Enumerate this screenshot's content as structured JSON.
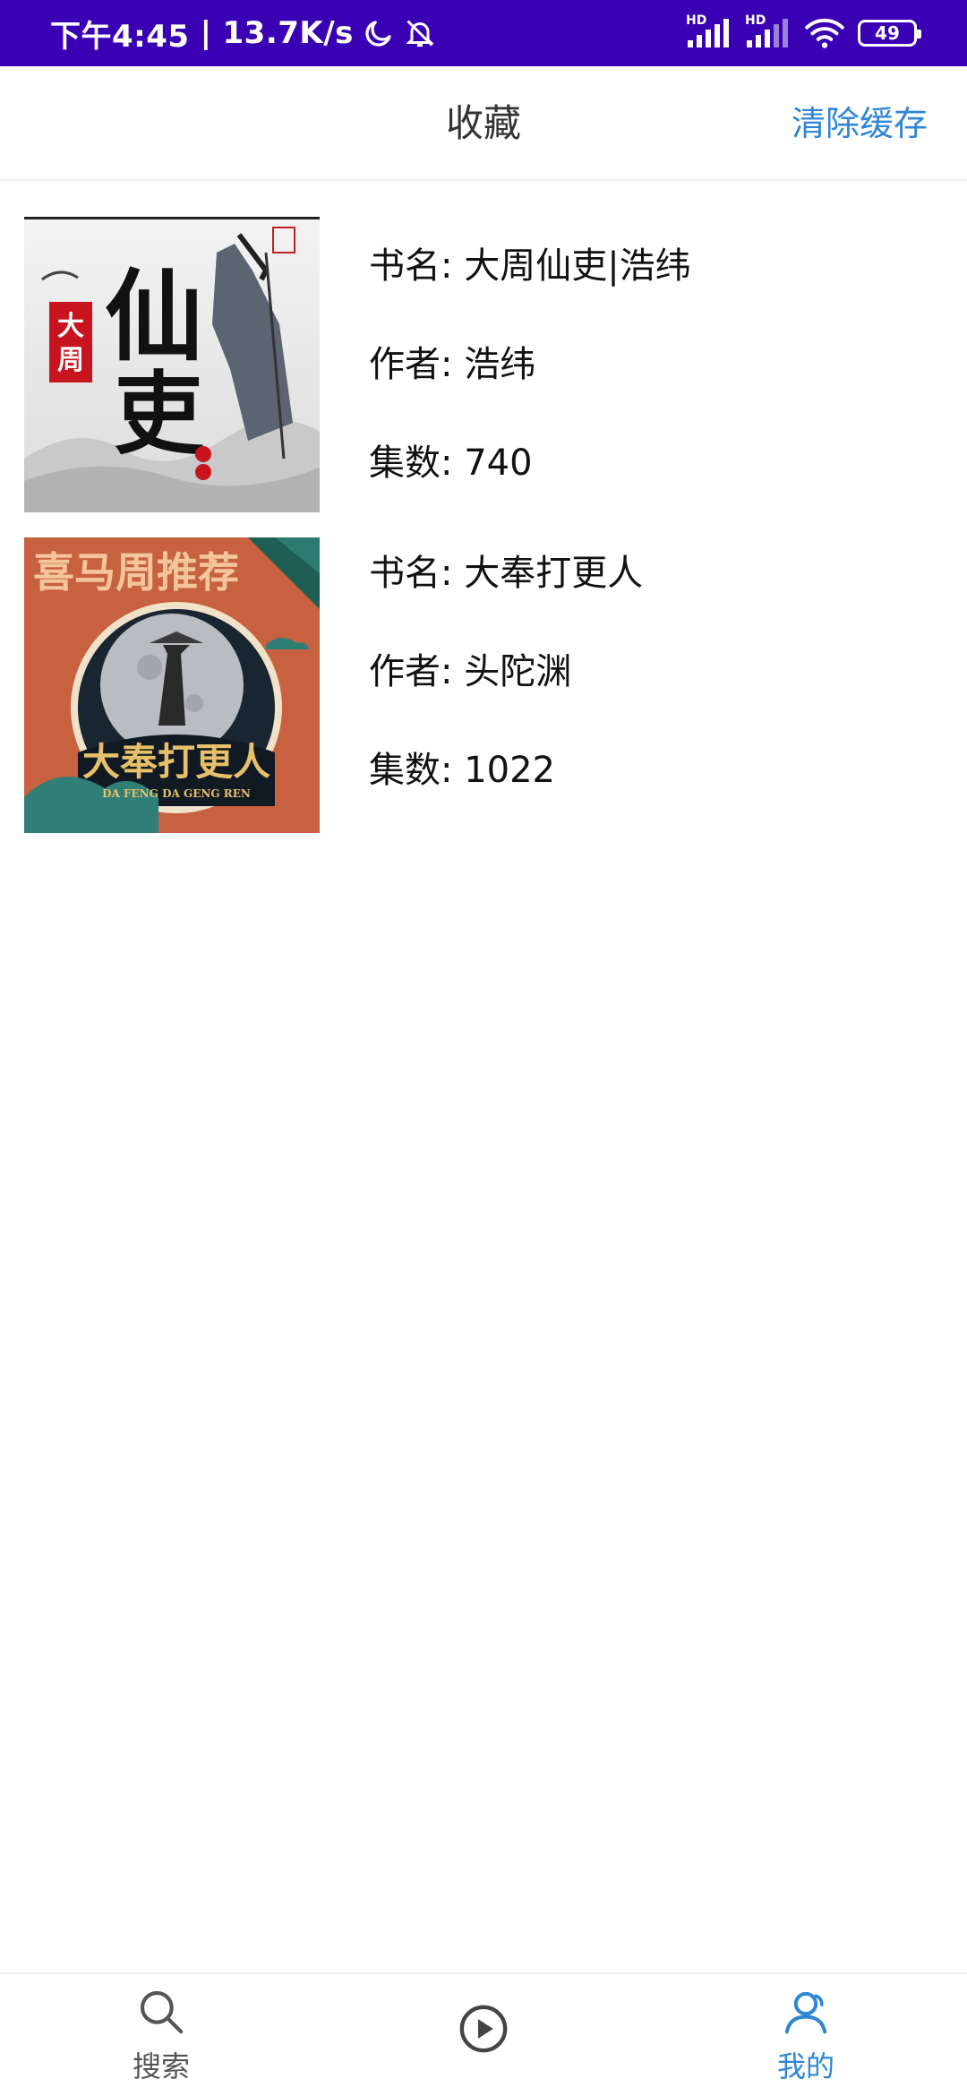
{
  "status_bar": {
    "time": "下午4:45",
    "separator": "|",
    "net_speed": "13.7K/s",
    "hd1": "HD",
    "hd2": "HD",
    "battery": "49",
    "icons": [
      "moon-icon",
      "bell-off-icon",
      "signal-icon",
      "signal-icon",
      "wifi-icon",
      "battery-icon"
    ]
  },
  "header": {
    "title": "收藏",
    "clear_cache_label": "清除缓存"
  },
  "favorites": [
    {
      "name_text": "书名: 大周仙吏|浩纬",
      "author_text": "作者: 浩纬",
      "episodes_text": "集数: 740",
      "cover_title": "仙吏",
      "cover_seal": "大周"
    },
    {
      "name_text": "书名: 大奉打更人",
      "author_text": "作者: 头陀渊",
      "episodes_text": "集数: 1022",
      "cover_banner": "喜马周推荐",
      "cover_title": "大奉打更人",
      "cover_subtitle": "DA FENG DA GENG REN"
    }
  ],
  "bottom_nav": {
    "items": [
      {
        "label": "搜索",
        "icon": "search-icon"
      },
      {
        "label": "",
        "icon": "play-icon"
      },
      {
        "label": "我的",
        "icon": "user-icon"
      }
    ]
  },
  "colors": {
    "status_bar": "#3a00b4",
    "accent": "#2f86d6",
    "divider": "#ececec"
  }
}
